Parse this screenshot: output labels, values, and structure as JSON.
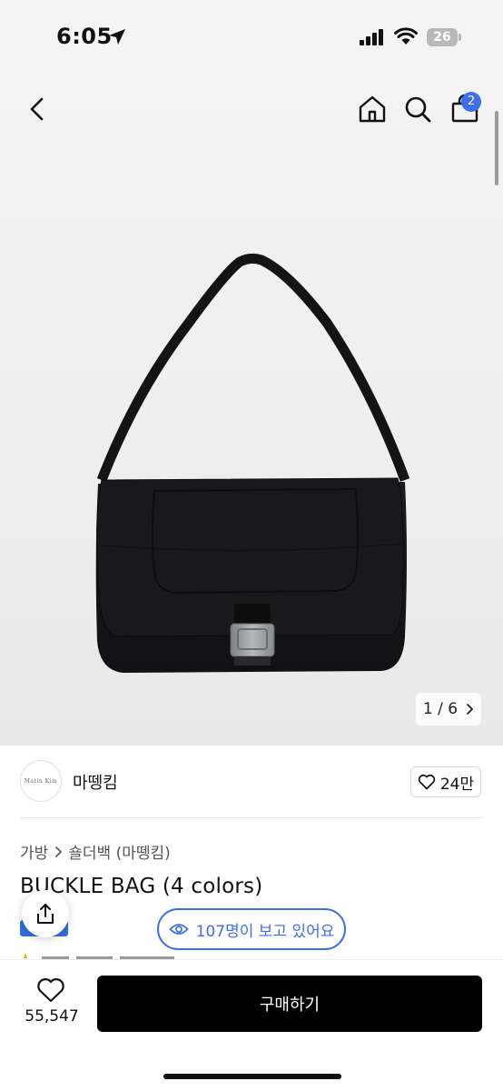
{
  "status_bar": {
    "time": "6:05",
    "battery": "26",
    "icons": [
      "location-arrow-icon",
      "cellular-signal-icon",
      "wifi-icon",
      "battery-icon"
    ]
  },
  "nav": {
    "icons": [
      "back-chevron-icon",
      "home-icon",
      "search-icon",
      "shopping-bag-icon"
    ],
    "cart_count": "2"
  },
  "gallery": {
    "indicator": "1 / 6",
    "next_icon": "chevron-right-icon",
    "image_subject": "black-buckle-shoulder-bag",
    "colors": {
      "background": "#efefef",
      "bag": "#161618",
      "buckle": "#9a9da2"
    }
  },
  "brand": {
    "logo_text": "Matin Kim",
    "name": "마뗑킴",
    "likes": "24만"
  },
  "breadcrumb": {
    "category": "가방",
    "subcategory": "숄더백 (마뗑킴)"
  },
  "product": {
    "title": "BUCKLE BAG (4 colors)"
  },
  "viewers": {
    "text": "107명이 보고 있어요"
  },
  "bottom_bar": {
    "wish_count": "55,547",
    "buy_label": "구매하기"
  },
  "colors": {
    "accent": "#3d6ef0",
    "buy_button": "#000000",
    "tag_blue": "#2f6fe0"
  }
}
